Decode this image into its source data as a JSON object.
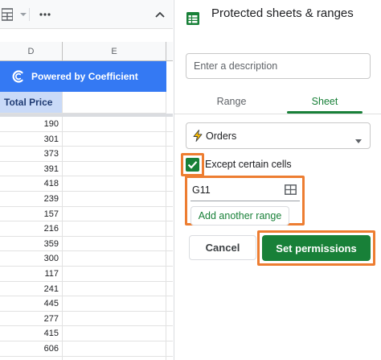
{
  "toolbar": {
    "icons": [
      "sheets-grid-icon",
      "chevron-down-icon",
      "more-icon",
      "chevron-up-icon"
    ]
  },
  "columns": {
    "d": "D",
    "e": "E"
  },
  "banner": {
    "text": "Powered by Coefficient"
  },
  "table": {
    "header": "Total Price",
    "values": [
      "190",
      "301",
      "373",
      "391",
      "418",
      "239",
      "157",
      "216",
      "359",
      "300",
      "117",
      "241",
      "445",
      "277",
      "415",
      "606",
      ""
    ]
  },
  "panel": {
    "title": "Protected sheets & ranges",
    "description_placeholder": "Enter a description",
    "tabs": {
      "range": "Range",
      "sheet": "Sheet",
      "active": "Sheet"
    },
    "sheet_select": "Orders",
    "except_label": "Except certain cells",
    "except_checked": true,
    "range_value": "G11",
    "add_range_label": "Add another range",
    "cancel_label": "Cancel",
    "set_label": "Set permissions"
  },
  "colors": {
    "accent_green": "#188038",
    "banner_blue": "#3479f3",
    "header_fill": "#c9daf8",
    "highlight_orange": "#ed7d31"
  }
}
